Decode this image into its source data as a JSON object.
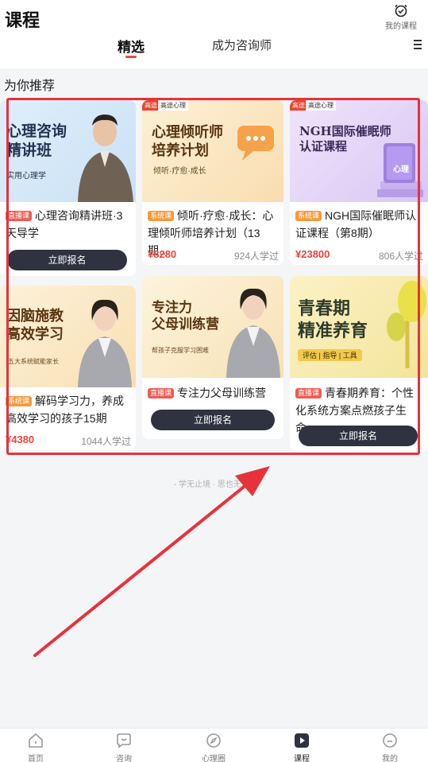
{
  "header": {
    "title": "课程",
    "my_courses_label": "我的课程"
  },
  "tabs": [
    {
      "label": "精选",
      "active": true
    },
    {
      "label": "成为咨询师",
      "active": false
    }
  ],
  "section_title": "为你推荐",
  "courses": [
    {
      "thumb_title_line1": "心理咨询",
      "thumb_title_line2": "精讲班",
      "thumb_sub": "实用心理学",
      "type_badge": "直播课",
      "title": "心理咨询精讲班·3天导学",
      "button": "立即报名"
    },
    {
      "corner_tag": "高途",
      "corner_brand": "高途心理",
      "thumb_title_line1": "心理倾听师",
      "thumb_title_line2": "培养计划",
      "thumb_sub": "倾听·疗愈·成长",
      "type_badge": "系统课",
      "title": "倾听·疗愈·成长：心理倾听师培养计划（13期…",
      "price": "¥8280",
      "learners": "924人学过"
    },
    {
      "corner_tag": "高途",
      "corner_brand": "高途心理",
      "thumb_title_line1": "NGH国际催眠师",
      "thumb_title_line2": "认证课程",
      "book_label": "心理",
      "type_badge": "系统课",
      "title": "NGH国际催眠师认证课程（第8期）",
      "price": "¥23800",
      "learners": "806人学过"
    },
    {
      "thumb_title_line1": "因脑施教",
      "thumb_title_line2": "高效学习",
      "thumb_sub": "五大系统赋能家长",
      "type_badge": "系统课",
      "title": "解码学习力，养成高效学习的孩子15期",
      "price": "¥4380",
      "learners": "1044人学过"
    },
    {
      "thumb_title_line1": "专注力",
      "thumb_title_line2": "父母训练营",
      "thumb_sub": "帮孩子克服学习困难",
      "type_badge": "直播课",
      "title": "专注力父母训练营",
      "button": "立即报名"
    },
    {
      "thumb_title_line1": "青春期",
      "thumb_title_line2": "精准养育",
      "thumb_tags": "评估 | 指导 | 工具",
      "type_badge": "直播课",
      "title": "青春期养育：个性化系统方案点燃孩子生命…",
      "button": "立即报名"
    }
  ],
  "footer_slogan": "- 学无止境 · 思也无涯 -",
  "bottom_nav": [
    {
      "label": "首页",
      "icon": "home-icon",
      "active": false
    },
    {
      "label": "咨询",
      "icon": "chat-heart-icon",
      "active": false
    },
    {
      "label": "心理圈",
      "icon": "compass-icon",
      "active": false
    },
    {
      "label": "课程",
      "icon": "play-icon",
      "active": true
    },
    {
      "label": "我的",
      "icon": "profile-icon",
      "active": false
    }
  ],
  "colors": {
    "accent": "#f04a3e",
    "highlight_box": "#e8323a",
    "button_dark": "#2f3240",
    "price": "#ef4338"
  }
}
